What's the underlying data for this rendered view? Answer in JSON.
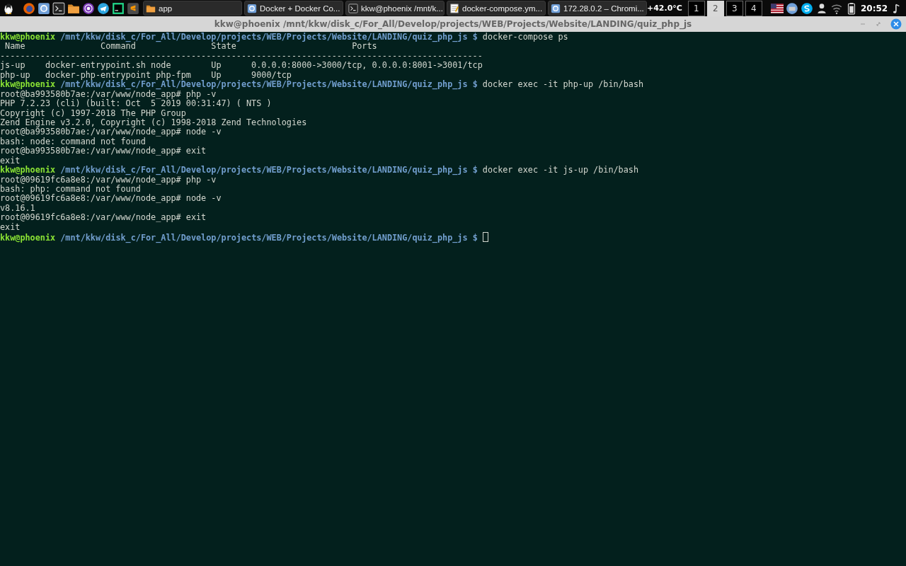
{
  "taskbar": {
    "launchers": [
      {
        "kind": "os"
      },
      {
        "kind": "firefox"
      },
      {
        "kind": "chromium"
      },
      {
        "kind": "terminal"
      },
      {
        "kind": "folder"
      },
      {
        "kind": "tor"
      },
      {
        "kind": "telegram"
      },
      {
        "kind": "pycharm"
      },
      {
        "kind": "sublime"
      }
    ],
    "tasks": [
      {
        "label": "app",
        "kind": "folder"
      },
      {
        "label": "Docker + Docker Co...",
        "kind": "chromium"
      },
      {
        "label": "kkw@phoenix /mnt/k...",
        "kind": "terminal"
      },
      {
        "label": "docker-compose.ym...",
        "kind": "editor"
      },
      {
        "label": "172.28.0.2 – Chromi...",
        "kind": "chromium"
      }
    ],
    "temperature": "+42.0°C",
    "workspaces": [
      {
        "label": "1",
        "selected": false
      },
      {
        "label": "2",
        "selected": true
      },
      {
        "label": "3",
        "selected": false
      },
      {
        "label": "4",
        "selected": false
      }
    ],
    "tray": [
      {
        "kind": "flag"
      },
      {
        "kind": "updates"
      },
      {
        "kind": "skype"
      },
      {
        "kind": "user"
      },
      {
        "kind": "wifi"
      },
      {
        "kind": "battery"
      }
    ],
    "clock": "20:52"
  },
  "window": {
    "title": "kkw@phoenix /mnt/kkw/disk_c/For_All/Develop/projects/WEB/Projects/Website/LANDING/quiz_php_js"
  },
  "terminal": {
    "lines": [
      {
        "kind": "prompt",
        "user": "kkw@phoenix",
        "path": "/mnt/kkw/disk_c/For_All/Develop/projects/WEB/Projects/Website/LANDING/quiz_php_js $",
        "command": "docker-compose ps"
      },
      {
        "kind": "output",
        "text": " Name               Command               State                       Ports"
      },
      {
        "kind": "output",
        "text": "------------------------------------------------------------------------------------------------"
      },
      {
        "kind": "output",
        "text": "js-up    docker-entrypoint.sh node        Up      0.0.0.0:8000->3000/tcp, 0.0.0.0:8001->3001/tcp"
      },
      {
        "kind": "output",
        "text": "php-up   docker-php-entrypoint php-fpm    Up      9000/tcp"
      },
      {
        "kind": "prompt",
        "user": "kkw@phoenix",
        "path": "/mnt/kkw/disk_c/For_All/Develop/projects/WEB/Projects/Website/LANDING/quiz_php_js $",
        "command": "docker exec -it php-up /bin/bash"
      },
      {
        "kind": "output",
        "text": "root@ba993580b7ae:/var/www/node_app# php -v"
      },
      {
        "kind": "output",
        "text": "PHP 7.2.23 (cli) (built: Oct  5 2019 00:31:47) ( NTS )"
      },
      {
        "kind": "output",
        "text": "Copyright (c) 1997-2018 The PHP Group"
      },
      {
        "kind": "output",
        "text": "Zend Engine v3.2.0, Copyright (c) 1998-2018 Zend Technologies"
      },
      {
        "kind": "output",
        "text": "root@ba993580b7ae:/var/www/node_app# node -v"
      },
      {
        "kind": "output",
        "text": "bash: node: command not found"
      },
      {
        "kind": "output",
        "text": "root@ba993580b7ae:/var/www/node_app# exit"
      },
      {
        "kind": "output",
        "text": "exit"
      },
      {
        "kind": "prompt",
        "user": "kkw@phoenix",
        "path": "/mnt/kkw/disk_c/For_All/Develop/projects/WEB/Projects/Website/LANDING/quiz_php_js $",
        "command": "docker exec -it js-up /bin/bash"
      },
      {
        "kind": "output",
        "text": "root@09619fc6a8e8:/var/www/node_app# php -v"
      },
      {
        "kind": "output",
        "text": "bash: php: command not found"
      },
      {
        "kind": "output",
        "text": "root@09619fc6a8e8:/var/www/node_app# node -v"
      },
      {
        "kind": "output",
        "text": "v8.16.1"
      },
      {
        "kind": "output",
        "text": "root@09619fc6a8e8:/var/www/node_app# exit"
      },
      {
        "kind": "output",
        "text": "exit"
      },
      {
        "kind": "cursor",
        "user": "kkw@phoenix",
        "path": "/mnt/kkw/disk_c/For_All/Develop/projects/WEB/Projects/Website/LANDING/quiz_php_js $"
      }
    ]
  }
}
